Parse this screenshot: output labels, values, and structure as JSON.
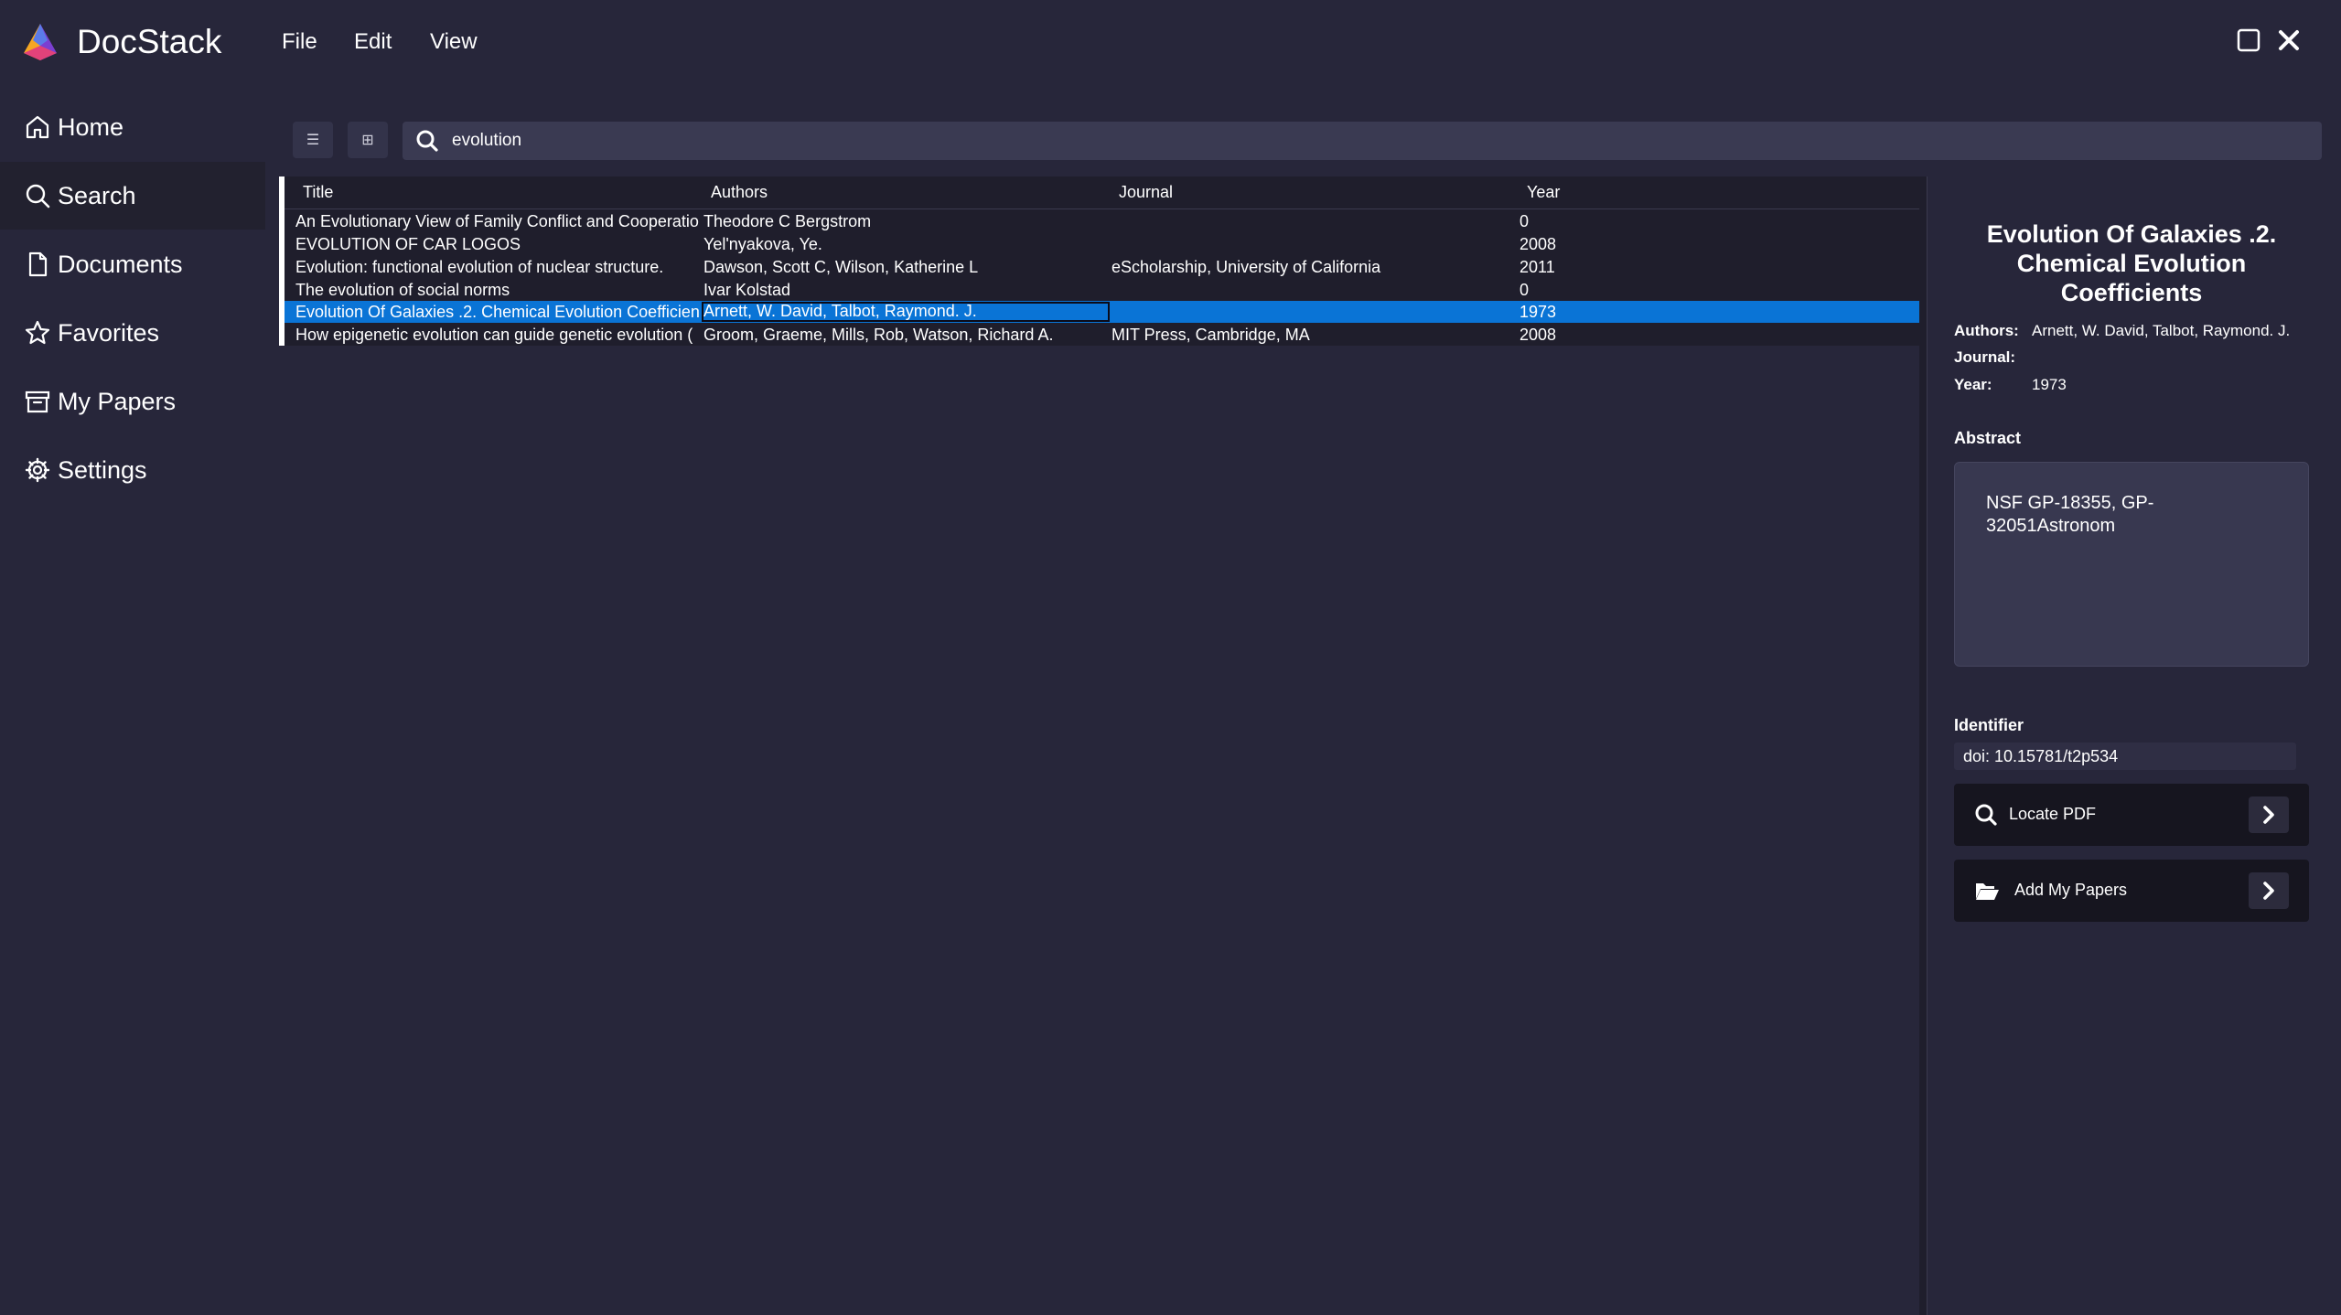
{
  "app": {
    "title": "DocStack"
  },
  "menu": {
    "file": "File",
    "edit": "Edit",
    "view": "View"
  },
  "sidebar": {
    "items": [
      {
        "label": "Home",
        "icon": "home-icon"
      },
      {
        "label": "Search",
        "icon": "search-icon"
      },
      {
        "label": "Documents",
        "icon": "document-icon"
      },
      {
        "label": "Favorites",
        "icon": "star-icon"
      },
      {
        "label": "My Papers",
        "icon": "archive-icon"
      },
      {
        "label": "Settings",
        "icon": "gear-icon"
      }
    ],
    "active": "Search"
  },
  "toolbar": {
    "list_view_glyph": "☰",
    "grid_view_glyph": "⊞"
  },
  "search": {
    "query": "evolution"
  },
  "table": {
    "columns": [
      "Title",
      "Authors",
      "Journal",
      "Year"
    ],
    "rows": [
      {
        "title": "An Evolutionary View of Family Conflict and Cooperatio",
        "authors": "Theodore C Bergstrom",
        "journal": "",
        "year": "0"
      },
      {
        "title": "EVOLUTION OF CAR LOGOS",
        "authors": "Yel'nyakova, Ye.",
        "journal": "",
        "year": "2008"
      },
      {
        "title": "Evolution: functional evolution of nuclear structure.",
        "authors": "Dawson, Scott C, Wilson, Katherine L",
        "journal": "eScholarship, University of California",
        "year": "2011"
      },
      {
        "title": "The evolution of social norms",
        "authors": "Ivar Kolstad",
        "journal": "",
        "year": "0"
      },
      {
        "title": "Evolution Of Galaxies .2. Chemical Evolution Coefficien",
        "authors": "Arnett, W. David, Talbot, Raymond. J.",
        "journal": "",
        "year": "1973"
      },
      {
        "title": "How epigenetic evolution can guide genetic evolution (",
        "authors": "Groom, Graeme, Mills, Rob, Watson, Richard A.",
        "journal": "MIT Press, Cambridge, MA",
        "year": "2008"
      }
    ],
    "selected_index": 4
  },
  "detail": {
    "title": "Evolution Of Galaxies .2. Chemical Evolution Coefficients",
    "authors_label": "Authors:",
    "authors": "Arnett, W. David, Talbot, Raymond. J.",
    "journal_label": "Journal:",
    "journal": "",
    "year_label": "Year:",
    "year": "1973",
    "abstract_label": "Abstract",
    "abstract": "NSF GP-18355, GP-32051Astronom",
    "identifier_label": "Identifier",
    "identifier": "doi: 10.15781/t2p534",
    "locate_pdf": "Locate PDF",
    "add_my_papers": "Add My Papers"
  },
  "colors": {
    "background": "#27263a",
    "selection": "#0a74d6",
    "panel": "#1f1e2c"
  }
}
